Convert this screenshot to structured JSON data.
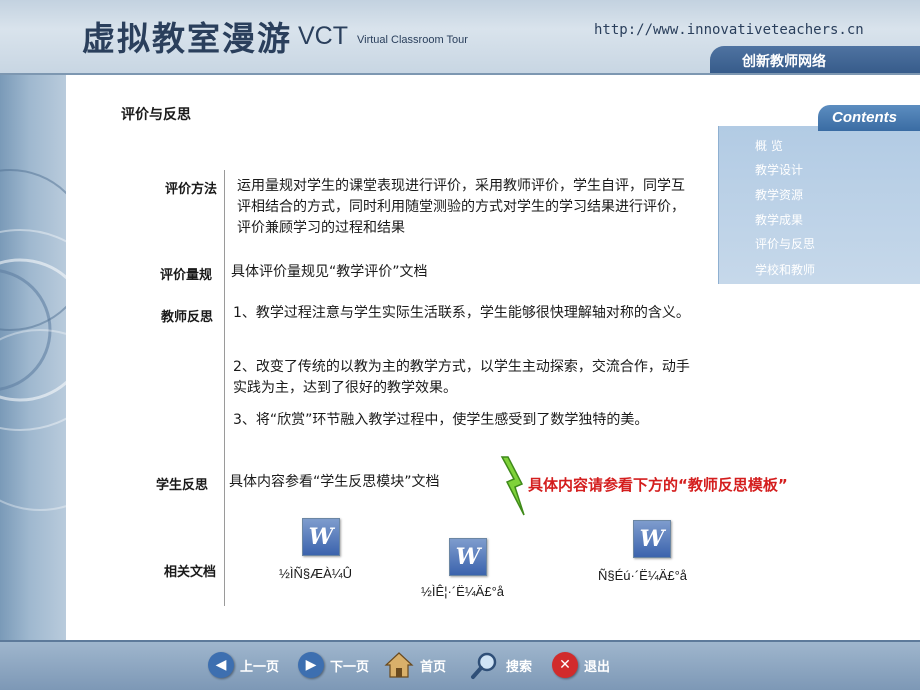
{
  "banner": {
    "title_zh": "虚拟教室漫游",
    "title_en": "VCT",
    "subtitle_en": "Virtual Classroom Tour",
    "url": "http://www.innovativeteachers.cn",
    "brand": "创新教师网络"
  },
  "page_title": "评价与反思",
  "rows": {
    "method_label": "评价方法",
    "method_text": "运用量规对学生的课堂表现进行评价，采用教师评价，学生自评，同学互评相结合的方式，同时利用随堂测验的方式对学生的学习结果进行评价，评价兼顾学习的过程和结果",
    "rubric_label": "评价量规",
    "rubric_text": "具体评价量规见“教学评价”文档",
    "reflection_label": "教师反思",
    "reflection_items": [
      "1、教学过程注意与学生实际生活联系，学生能够很快理解轴对称的含义。",
      "2、改变了传统的以教为主的教学方式，以学生主动探索，交流合作，动手 实践为主，达到了很好的教学效果。",
      "3、将“欣赏”环节融入教学过程中，使学生感受到了数学独特的美。"
    ],
    "student_label": "学生反思",
    "student_text": "具体内容参看“学生反思模块”文档",
    "annotation": "具体内容请参看下方的“教师反思模板”",
    "docs_label": "相关文档"
  },
  "docs": [
    {
      "icon": "word-document-icon",
      "glyph": "W",
      "name": "½ÌÑ§ÆÀ¼Û"
    },
    {
      "icon": "word-document-icon",
      "glyph": "W",
      "name": "½ÌÊ¦·´Ë¼Ä£°å"
    },
    {
      "icon": "word-document-icon",
      "glyph": "W",
      "name": "Ñ§Éú·´Ë¼Ä£°å"
    }
  ],
  "contents": {
    "heading": "Contents",
    "items": [
      "概  览",
      "教学设计",
      "教学资源",
      "教学成果",
      "评价与反思",
      "学校和教师"
    ]
  },
  "footer": {
    "prev": "上一页",
    "next": "下一页",
    "home": "首页",
    "search": "搜索",
    "exit": "退出"
  },
  "colors": {
    "banner": "#c3d2e0",
    "accent_blue": "#3a6ca3",
    "annotation_red": "#d41e1e",
    "footer": "#7d98b6"
  }
}
